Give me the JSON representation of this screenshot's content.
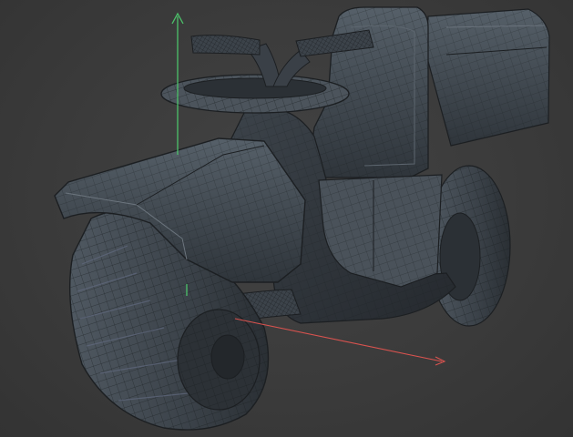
{
  "viewport": {
    "background": "#3a3a3a",
    "model_base_color": "#3f454c",
    "wire_color": "#1c1f22",
    "highlight_color": "#5a626b"
  },
  "gizmo": {
    "x_axis_color": "#d9534f",
    "y_axis_color": "#4cc26a"
  },
  "icons": {
    "x_axis": "red-arrow",
    "y_axis": "green-arrow"
  }
}
